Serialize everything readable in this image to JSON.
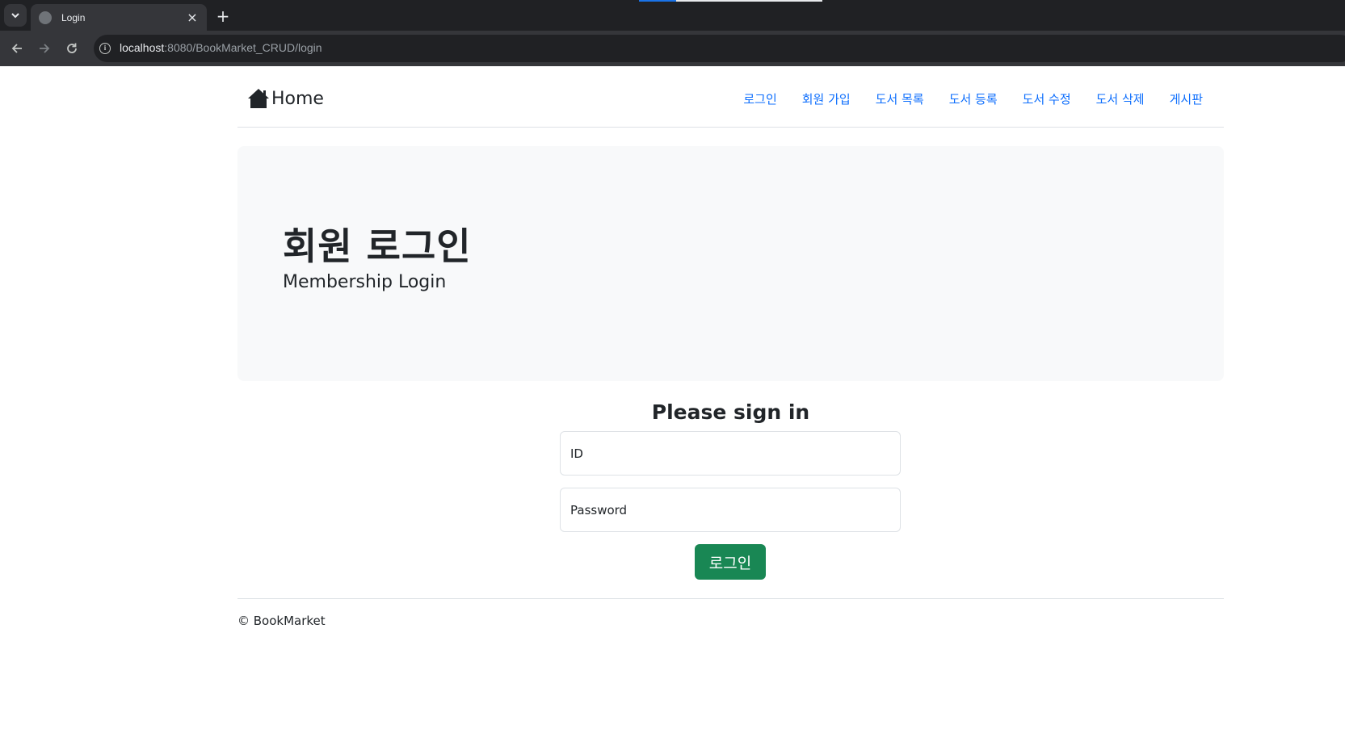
{
  "browser": {
    "tab_title": "Login",
    "tab_close": "×",
    "new_tab": "+",
    "url_host": "localhost",
    "url_rest": ":8080/BookMarket_CRUD/login",
    "icons": [
      "chevron-down-icon",
      "globe-icon",
      "close-icon",
      "plus-icon",
      "back-arrow-icon",
      "forward-arrow-icon",
      "reload-icon",
      "info-icon"
    ]
  },
  "navbar": {
    "brand": "Home",
    "links": [
      "로그인",
      "회원 가입",
      "도서 목록",
      "도서 등록",
      "도서 수정",
      "도서 삭제",
      "게시판"
    ]
  },
  "hero": {
    "title": "회원 로그인",
    "subtitle": "Membership Login"
  },
  "form": {
    "heading": "Please sign in",
    "id_placeholder": "ID",
    "password_placeholder": "Password",
    "submit_label": "로그인"
  },
  "footer": {
    "copyright": "© BookMarket"
  },
  "colors": {
    "link": "#0d6efd",
    "button": "#198754",
    "hero_bg": "#f8f9fa",
    "chrome_dark": "#202124"
  }
}
